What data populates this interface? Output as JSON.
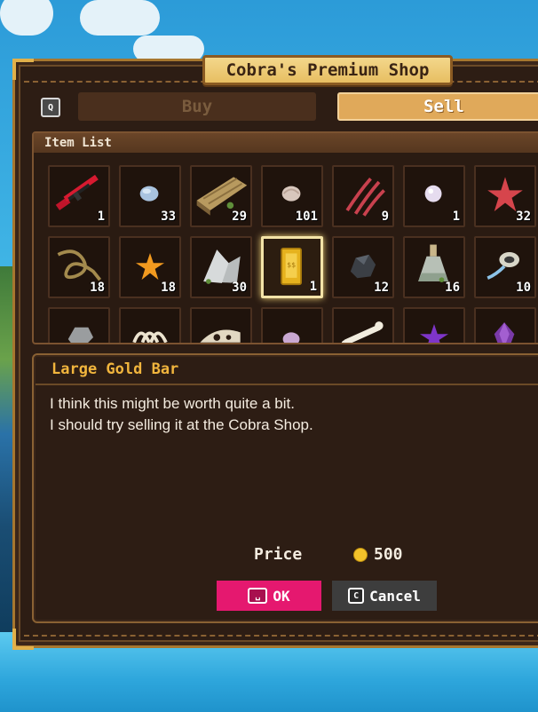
{
  "window": {
    "title": "Cobra's Premium Shop"
  },
  "tabs": {
    "key_hint": "Q",
    "buy_label": "Buy",
    "sell_label": "Sell",
    "active": "Sell"
  },
  "item_list": {
    "header": "Item List",
    "rows": [
      [
        {
          "icon": "rifle-icon",
          "qty": "1"
        },
        {
          "icon": "blue-pebble-icon",
          "qty": "33"
        },
        {
          "icon": "wooden-log-icon",
          "qty": "29"
        },
        {
          "icon": "seashell-icon",
          "qty": "101"
        },
        {
          "icon": "claw-marks-icon",
          "qty": "9"
        },
        {
          "icon": "pearl-icon",
          "qty": "1"
        },
        {
          "icon": "starfish-red-icon",
          "qty": "32"
        }
      ],
      [
        {
          "icon": "rope-icon",
          "qty": "18"
        },
        {
          "icon": "starfish-orange-icon",
          "qty": "18"
        },
        {
          "icon": "rock-shard-icon",
          "qty": "30"
        },
        {
          "icon": "gold-bar-icon",
          "qty": "1",
          "selected": true
        },
        {
          "icon": "coal-ore-icon",
          "qty": "12"
        },
        {
          "icon": "potion-bottle-icon",
          "qty": "16"
        },
        {
          "icon": "mussel-icon",
          "qty": "10"
        }
      ],
      [
        {
          "icon": "stone-icon",
          "qty": ""
        },
        {
          "icon": "ribcage-bone-icon",
          "qty": ""
        },
        {
          "icon": "skull-fossil-icon",
          "qty": ""
        },
        {
          "icon": "purple-shell-icon",
          "qty": ""
        },
        {
          "icon": "bone-icon",
          "qty": ""
        },
        {
          "icon": "purple-starfish-icon",
          "qty": ""
        },
        {
          "icon": "amethyst-icon",
          "qty": ""
        }
      ]
    ]
  },
  "detail": {
    "item_name": "Large Gold Bar",
    "description_line1": "I think this might be worth quite a bit.",
    "description_line2": "I should try selling it at the Cobra Shop.",
    "price_label": "Price",
    "price_value": "500"
  },
  "actions": {
    "ok_label": "OK",
    "cancel_label": "Cancel",
    "cancel_key": "C"
  }
}
